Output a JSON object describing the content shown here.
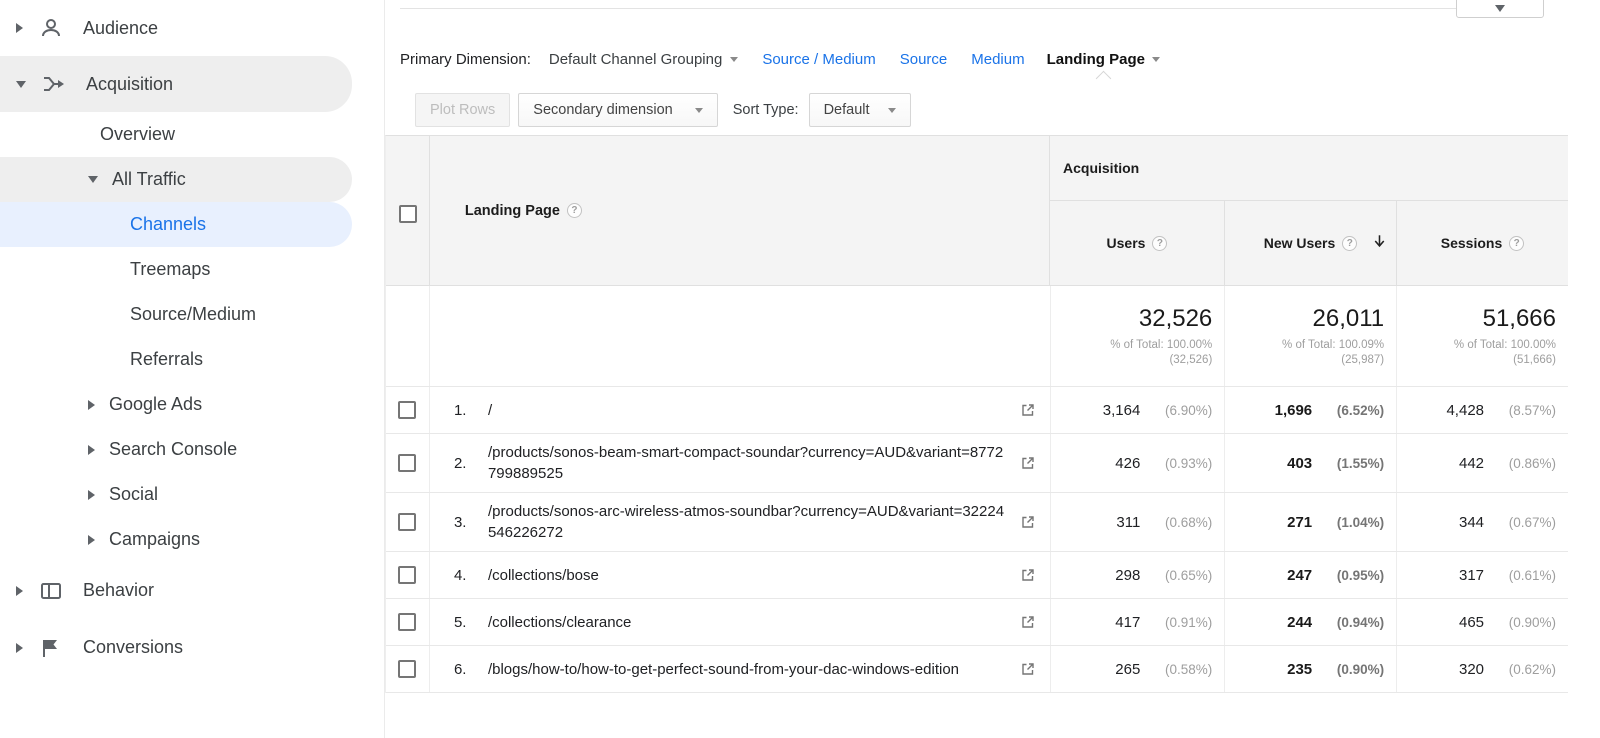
{
  "glyphs": {
    "help": "?"
  },
  "sidebar": {
    "items": [
      {
        "label": "Audience",
        "icon": "person-icon",
        "state": "collapsed"
      },
      {
        "label": "Acquisition",
        "icon": "acquisition-icon",
        "state": "expanded"
      },
      {
        "label": "Overview"
      },
      {
        "label": "All Traffic",
        "state": "expanded"
      },
      {
        "label": "Channels",
        "selected": true
      },
      {
        "label": "Treemaps"
      },
      {
        "label": "Source/Medium"
      },
      {
        "label": "Referrals"
      },
      {
        "label": "Google Ads",
        "state": "collapsed"
      },
      {
        "label": "Search Console",
        "state": "collapsed"
      },
      {
        "label": "Social",
        "state": "collapsed"
      },
      {
        "label": "Campaigns",
        "state": "collapsed"
      },
      {
        "label": "Behavior",
        "icon": "behavior-icon",
        "state": "collapsed"
      },
      {
        "label": "Conversions",
        "icon": "flag-icon",
        "state": "collapsed"
      }
    ]
  },
  "dimension_bar": {
    "label": "Primary Dimension:",
    "default_option": "Default Channel Grouping",
    "links": [
      "Source / Medium",
      "Source",
      "Medium"
    ],
    "selected": "Landing Page"
  },
  "toolbar": {
    "plot_rows": "Plot Rows",
    "secondary_dimension": "Secondary dimension",
    "sort_type_label": "Sort Type:",
    "sort_type_value": "Default"
  },
  "table": {
    "group_header": "Acquisition",
    "dimension_column": "Landing Page",
    "metrics": [
      {
        "label": "Users",
        "total": "32,526",
        "pct_total": "% of Total: 100.00%",
        "pct_paren": "(32,526)"
      },
      {
        "label": "New Users",
        "total": "26,011",
        "pct_total": "% of Total: 100.09%",
        "pct_paren": "(25,987)",
        "sorted": "desc"
      },
      {
        "label": "Sessions",
        "total": "51,666",
        "pct_total": "% of Total: 100.00%",
        "pct_paren": "(51,666)"
      }
    ],
    "rows": [
      {
        "index": "1.",
        "landing_page": "/",
        "users": "3,164",
        "users_pct": "(6.90%)",
        "new_users": "1,696",
        "new_users_pct": "(6.52%)",
        "sessions": "4,428",
        "sessions_pct": "(8.57%)"
      },
      {
        "index": "2.",
        "landing_page": "/products/sonos-beam-smart-compact-soundar?currency=AUD&variant=8772799889525",
        "users": "426",
        "users_pct": "(0.93%)",
        "new_users": "403",
        "new_users_pct": "(1.55%)",
        "sessions": "442",
        "sessions_pct": "(0.86%)"
      },
      {
        "index": "3.",
        "landing_page": "/products/sonos-arc-wireless-atmos-soundbar?currency=AUD&variant=32224546226272",
        "users": "311",
        "users_pct": "(0.68%)",
        "new_users": "271",
        "new_users_pct": "(1.04%)",
        "sessions": "344",
        "sessions_pct": "(0.67%)"
      },
      {
        "index": "4.",
        "landing_page": "/collections/bose",
        "users": "298",
        "users_pct": "(0.65%)",
        "new_users": "247",
        "new_users_pct": "(0.95%)",
        "sessions": "317",
        "sessions_pct": "(0.61%)"
      },
      {
        "index": "5.",
        "landing_page": "/collections/clearance",
        "users": "417",
        "users_pct": "(0.91%)",
        "new_users": "244",
        "new_users_pct": "(0.94%)",
        "sessions": "465",
        "sessions_pct": "(0.90%)"
      },
      {
        "index": "6.",
        "landing_page": "/blogs/how-to/how-to-get-perfect-sound-from-your-dac-windows-edition",
        "users": "265",
        "users_pct": "(0.58%)",
        "new_users": "235",
        "new_users_pct": "(0.90%)",
        "sessions": "320",
        "sessions_pct": "(0.62%)"
      }
    ]
  },
  "colors": {
    "link_blue": "#1a73e8",
    "selected_bg": "#e8f0fe",
    "highlight_gray": "#eeeeee",
    "border": "#e0e0e0",
    "percent_gray": "#9e9e9e"
  }
}
